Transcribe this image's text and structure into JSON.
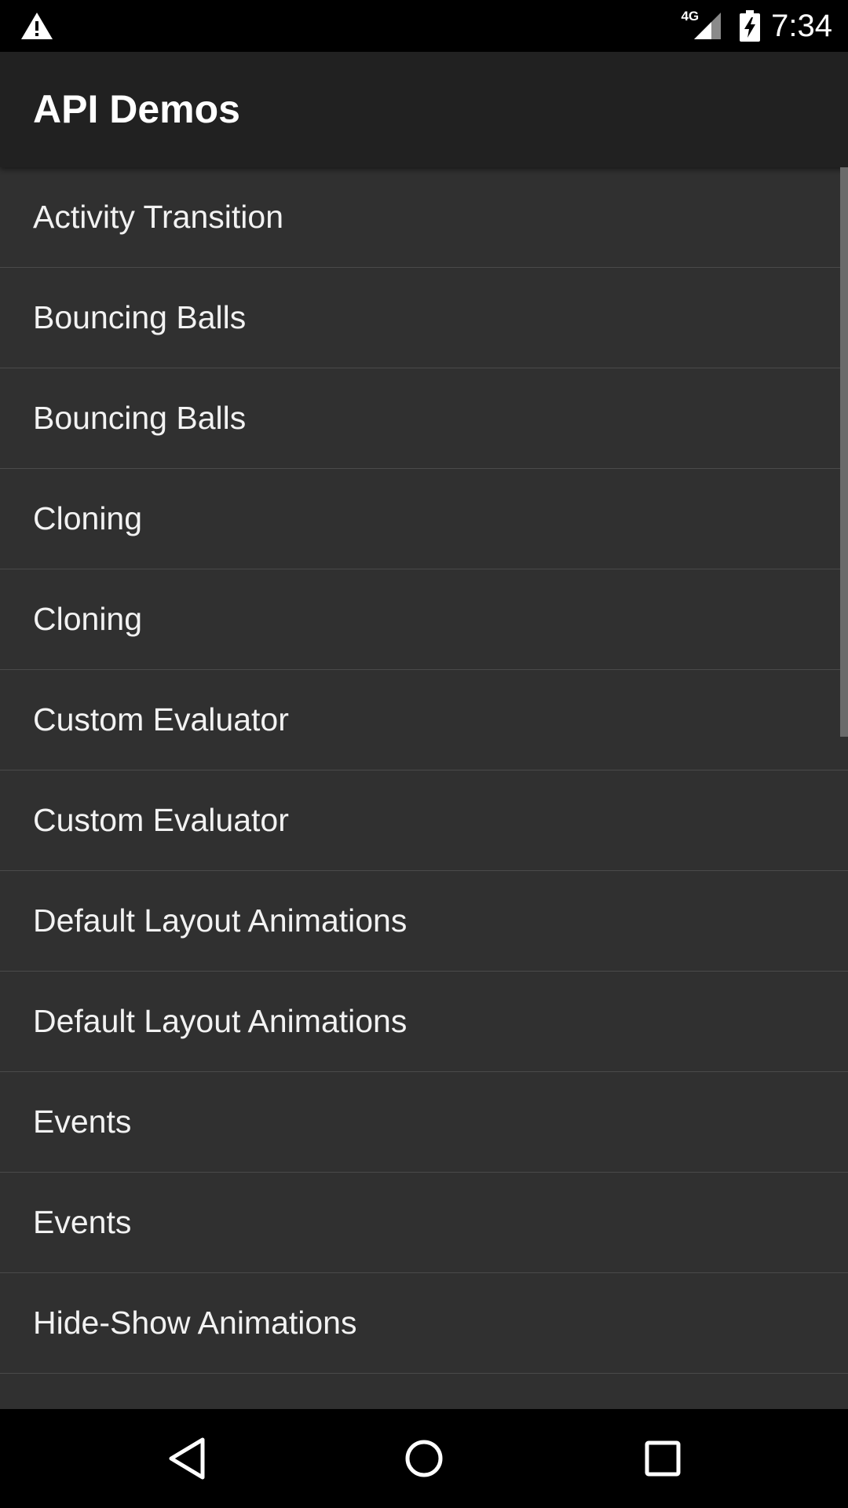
{
  "status_bar": {
    "network": "4G",
    "time": "7:34",
    "icons": [
      "warning-icon",
      "signal-icon",
      "battery-charging-icon"
    ]
  },
  "app_bar": {
    "title": "API Demos"
  },
  "list": {
    "items": [
      {
        "label": "Activity Transition"
      },
      {
        "label": "Bouncing Balls"
      },
      {
        "label": "Bouncing Balls"
      },
      {
        "label": "Cloning"
      },
      {
        "label": "Cloning"
      },
      {
        "label": "Custom Evaluator"
      },
      {
        "label": "Custom Evaluator"
      },
      {
        "label": "Default Layout Animations"
      },
      {
        "label": "Default Layout Animations"
      },
      {
        "label": "Events"
      },
      {
        "label": "Events"
      },
      {
        "label": "Hide-Show Animations"
      },
      {
        "label": ""
      }
    ]
  },
  "nav_bar": {
    "icons": [
      "back-icon",
      "home-icon",
      "recents-icon"
    ]
  },
  "colors": {
    "status_bar": "#000000",
    "app_bar": "#212121",
    "list_background": "#303030",
    "divider": "#4a4a4a",
    "text": "#f2f2f2"
  }
}
